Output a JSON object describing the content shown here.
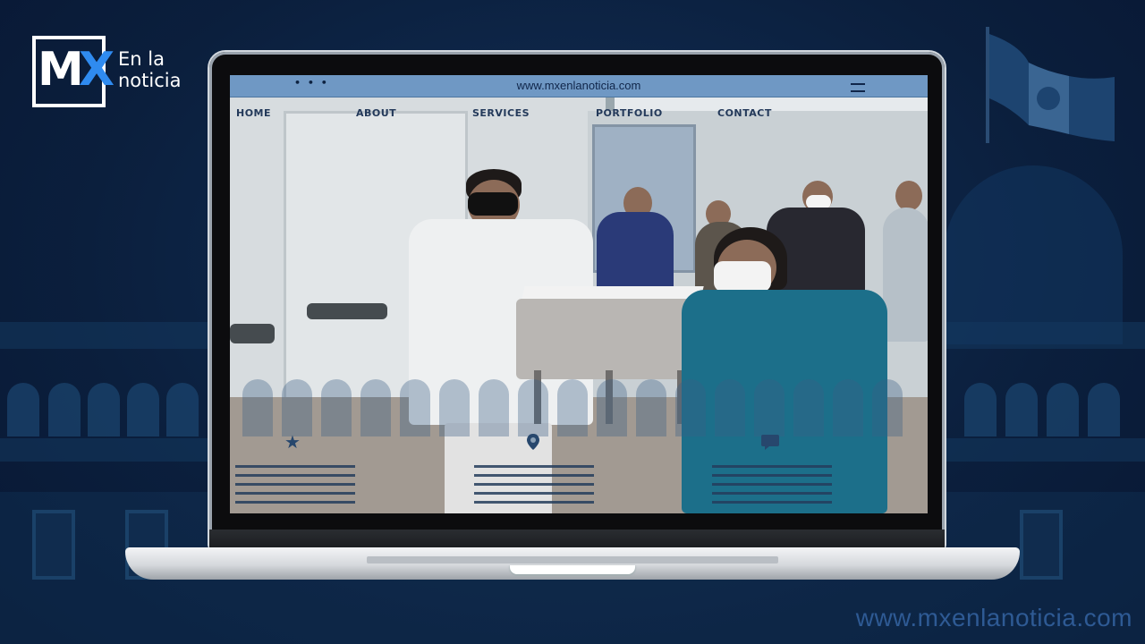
{
  "brand": {
    "logo_mark": "MX",
    "logo_text": "En la noticia",
    "watermark": "www.mxenlanoticia.com"
  },
  "browser": {
    "window_dots": "• • •",
    "url": "www.mxenlanoticia.com",
    "menu_icon": "hamburger-icon"
  },
  "nav": {
    "items": [
      "HOME",
      "ABOUT",
      "SERVICES",
      "PORTFOLIO",
      "CONTACT"
    ]
  },
  "features": {
    "icons": [
      "star-icon",
      "location-pin-icon",
      "chat-icon"
    ]
  },
  "colors": {
    "background": "#0b1f3d",
    "accent": "#2f8bf0",
    "urlbar": "#6f98c4"
  }
}
